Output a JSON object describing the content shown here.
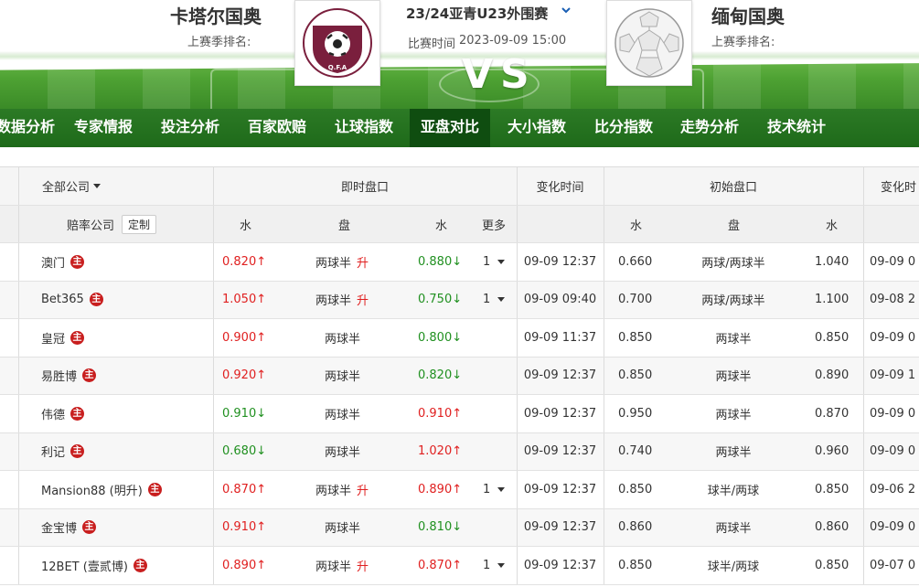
{
  "match": {
    "home_team": "卡塔尔国奥",
    "away_team": "缅甸国奥",
    "home_rank_label": "上赛季排名:",
    "away_rank_label": "上赛季排名:",
    "league": "23/24亚青U23外围赛",
    "match_time_label": "比赛时间",
    "match_time": "2023-09-09 15:00",
    "vs": "VS",
    "home_logo_text": "Q.F.A"
  },
  "nav": {
    "items": [
      "数据分析",
      "专家情报",
      "投注分析",
      "百家欧赔",
      "让球指数",
      "亚盘对比",
      "大小指数",
      "比分指数",
      "走势分析",
      "技术统计"
    ],
    "active_index": 5
  },
  "table": {
    "header1": {
      "company_filter": "全部公司",
      "live": "即时盘口",
      "change_time": "变化时间",
      "initial": "初始盘口",
      "change_time2": "变化时"
    },
    "header2": {
      "odds_company": "赔率公司",
      "custom": "定制",
      "water1": "水",
      "handicap": "盘",
      "water2": "水",
      "more": "更多",
      "init_water1": "水",
      "init_handicap": "盘",
      "init_water2": "水"
    },
    "badge": "主",
    "rise_label": "升",
    "rows": [
      {
        "company": "澳门",
        "w1": "0.820",
        "w1_dir": "up",
        "handicap": "两球半",
        "rise": true,
        "w2": "0.880",
        "w2_dir": "down",
        "more": "1",
        "time": "09-09 12:37",
        "iw1": "0.660",
        "ihandicap": "两球/两球半",
        "iw2": "1.040",
        "time2": "09-09 0"
      },
      {
        "company": "Bet365",
        "w1": "1.050",
        "w1_dir": "up",
        "handicap": "两球半",
        "rise": true,
        "w2": "0.750",
        "w2_dir": "down",
        "more": "1",
        "time": "09-09 09:40",
        "iw1": "0.700",
        "ihandicap": "两球/两球半",
        "iw2": "1.100",
        "time2": "09-08 2"
      },
      {
        "company": "皇冠",
        "w1": "0.900",
        "w1_dir": "up",
        "handicap": "两球半",
        "rise": false,
        "w2": "0.800",
        "w2_dir": "down",
        "more": "",
        "time": "09-09 11:37",
        "iw1": "0.850",
        "ihandicap": "两球半",
        "iw2": "0.850",
        "time2": "09-09 0"
      },
      {
        "company": "易胜博",
        "w1": "0.920",
        "w1_dir": "up",
        "handicap": "两球半",
        "rise": false,
        "w2": "0.820",
        "w2_dir": "down",
        "more": "",
        "time": "09-09 12:37",
        "iw1": "0.850",
        "ihandicap": "两球半",
        "iw2": "0.890",
        "time2": "09-09 1"
      },
      {
        "company": "伟德",
        "w1": "0.910",
        "w1_dir": "down",
        "handicap": "两球半",
        "rise": false,
        "w2": "0.910",
        "w2_dir": "up",
        "more": "",
        "time": "09-09 12:37",
        "iw1": "0.950",
        "ihandicap": "两球半",
        "iw2": "0.870",
        "time2": "09-09 0"
      },
      {
        "company": "利记",
        "w1": "0.680",
        "w1_dir": "down",
        "handicap": "两球半",
        "rise": false,
        "w2": "1.020",
        "w2_dir": "up",
        "more": "",
        "time": "09-09 12:37",
        "iw1": "0.740",
        "ihandicap": "两球半",
        "iw2": "0.960",
        "time2": "09-09 0"
      },
      {
        "company": "Mansion88 (明升)",
        "w1": "0.870",
        "w1_dir": "up",
        "handicap": "两球半",
        "rise": true,
        "w2": "0.890",
        "w2_dir": "up",
        "more": "1",
        "time": "09-09 12:37",
        "iw1": "0.850",
        "ihandicap": "球半/两球",
        "iw2": "0.850",
        "time2": "09-06 2"
      },
      {
        "company": "金宝博",
        "w1": "0.910",
        "w1_dir": "up",
        "handicap": "两球半",
        "rise": false,
        "w2": "0.810",
        "w2_dir": "down",
        "more": "",
        "time": "09-09 12:37",
        "iw1": "0.860",
        "ihandicap": "两球半",
        "iw2": "0.860",
        "time2": "09-09 0"
      },
      {
        "company": "12BET (壹贰博)",
        "w1": "0.890",
        "w1_dir": "up",
        "handicap": "两球半",
        "rise": true,
        "w2": "0.870",
        "w2_dir": "up",
        "more": "1",
        "time": "09-09 12:37",
        "iw1": "0.850",
        "ihandicap": "球半/两球",
        "iw2": "0.850",
        "time2": "09-07 0"
      }
    ]
  },
  "colors": {
    "nav_bg": "#2c7a25",
    "nav_active": "#0f4d10",
    "up": "#e02020",
    "down": "#209020",
    "badge": "#c81e1e"
  }
}
